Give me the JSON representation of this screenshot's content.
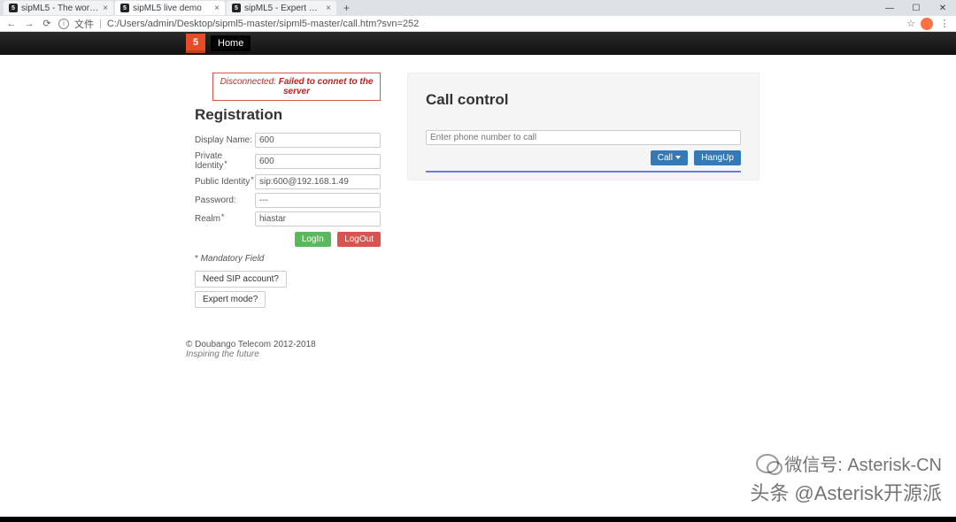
{
  "browser": {
    "tabs": [
      {
        "title": "sipML5 - The world's first ope…"
      },
      {
        "title": "sipML5 live demo"
      },
      {
        "title": "sipML5 - Expert mode"
      }
    ],
    "url_prefix": "文件",
    "url": "C:/Users/admin/Desktop/sipml5-master/sipml5-master/call.htm?svn=252"
  },
  "navbar": {
    "home": "Home"
  },
  "alert": {
    "status": "Disconnected:",
    "message": "Failed to connet to the server"
  },
  "registration": {
    "heading": "Registration",
    "labels": {
      "display_name": "Display Name:",
      "private_identity": "Private Identity",
      "public_identity": "Public Identity",
      "password": "Password:",
      "realm": "Realm"
    },
    "values": {
      "display_name": "600",
      "private_identity": "600",
      "public_identity": "sip:600@192.168.1.49",
      "password": "---",
      "realm": "hiastar"
    },
    "login": "LogIn",
    "logout": "LogOut",
    "mandatory": "Mandatory Field",
    "need_sip": "Need SIP account?",
    "expert": "Expert mode?"
  },
  "call": {
    "heading": "Call control",
    "placeholder": "Enter phone number to call",
    "call_btn": "Call",
    "hangup_btn": "HangUp"
  },
  "footer": {
    "copyright": "© Doubango Telecom 2012-2018",
    "inspire": "Inspiring the future"
  },
  "watermark": {
    "line1": "微信号: Asterisk-CN",
    "line2": "头条 @Asterisk开源派"
  }
}
